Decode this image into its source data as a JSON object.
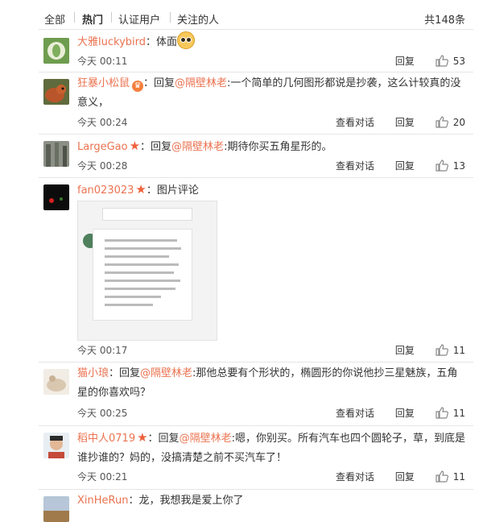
{
  "tabs": {
    "all": "全部",
    "hot": "热门",
    "verified": "认证用户",
    "following": "关注的人",
    "total": "共148条"
  },
  "comments": [
    {
      "user": "大雅luckybird",
      "sep": "：",
      "text": "体面",
      "time": "今天 00:11",
      "reply": "回复",
      "likes": "53"
    },
    {
      "user": "狂暴小松鼠",
      "sep": "：回复",
      "reply_to": "@隔壁林老",
      "text": ":一个简单的几何图形都说是抄袭，这么计较真的没意义，",
      "time": "今天 00:24",
      "view": "查看对话",
      "reply": "回复",
      "likes": "20"
    },
    {
      "user": "LargeGao",
      "sep": "：回复",
      "reply_to": "@隔壁林老",
      "text": ":期待你买五角星形的。",
      "time": "今天 00:28",
      "view": "查看对话",
      "reply": "回复",
      "likes": "13"
    },
    {
      "user": "fan023023",
      "sep": "：",
      "text": "图片评论",
      "time": "今天 00:17",
      "reply": "回复",
      "likes": "11"
    },
    {
      "user": "猫小琅",
      "sep": "：回复",
      "reply_to": "@隔壁林老",
      "text": ":那他总要有个形状的，椭圆形的你说他抄三星魅族，五角星的你喜欢吗？",
      "time": "今天 00:25",
      "view": "查看对话",
      "reply": "回复",
      "likes": "11"
    },
    {
      "user": "稻中人0719",
      "sep": "：回复",
      "reply_to": "@隔壁林老",
      "text": ":嗯，你别买。所有汽车也四个圆轮子，草，到底是谁抄谁的？妈的，没搞清楚之前不买汽车了！",
      "time": "今天 00:21",
      "view": "查看对话",
      "reply": "回复",
      "likes": "11"
    },
    {
      "user": "XinHeRun",
      "sep": "：",
      "text": "龙，我想我是爱上你了"
    }
  ],
  "icons": {
    "thumb": "thumbs-up-icon",
    "star": "star-badge-icon",
    "emoji": "emoji-icon"
  },
  "colors": {
    "username": "#eb7350",
    "badge": "#f0603c"
  }
}
